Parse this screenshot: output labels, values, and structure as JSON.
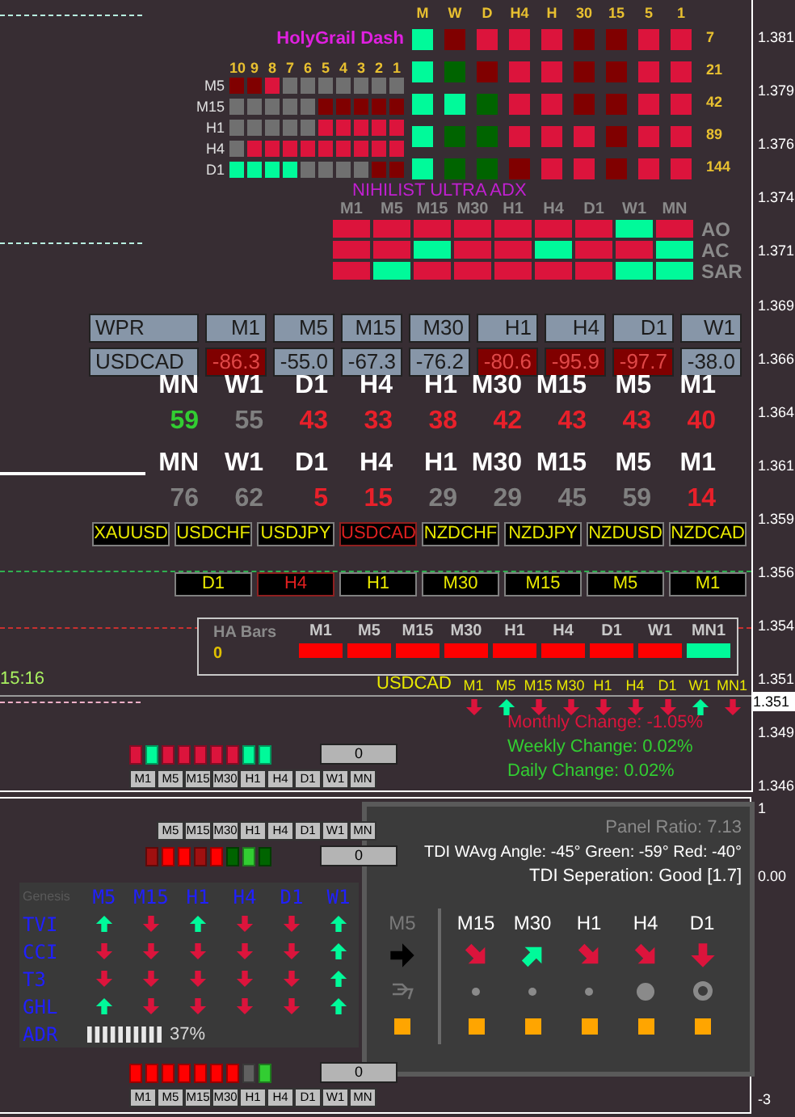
{
  "price_axis": {
    "labels": [
      "1.381",
      "1.379",
      "1.376",
      "1.374",
      "1.371",
      "1.369",
      "1.366",
      "1.364",
      "1.361",
      "1.359",
      "1.356",
      "1.354",
      "1.351",
      "1.349",
      "1.346"
    ],
    "current_price": "1.351"
  },
  "time_label": "15:16",
  "holygrail": {
    "title": "HolyGrail Dash",
    "columns": [
      "M",
      "W",
      "D",
      "H4",
      "H",
      "30",
      "15",
      "5",
      "1"
    ],
    "rows": [
      {
        "period": "7",
        "cells": [
          {
            "color": "#00fa9a"
          },
          {
            "color": "#800000"
          },
          {
            "color": "#dc143c"
          },
          {
            "color": "#dc143c"
          },
          {
            "color": "#dc143c"
          },
          {
            "color": "#800000"
          },
          {
            "color": "#800000"
          },
          {
            "color": "#dc143c"
          },
          {
            "color": "#dc143c"
          }
        ]
      },
      {
        "period": "21",
        "cells": [
          {
            "color": "#00fa9a"
          },
          {
            "color": "#006400"
          },
          {
            "color": "#800000"
          },
          {
            "color": "#dc143c"
          },
          {
            "color": "#dc143c"
          },
          {
            "color": "#800000"
          },
          {
            "color": "#800000"
          },
          {
            "color": "#dc143c"
          },
          {
            "color": "#dc143c"
          }
        ]
      },
      {
        "period": "42",
        "cells": [
          {
            "color": "#00fa9a"
          },
          {
            "color": "#00fa9a"
          },
          {
            "color": "#006400"
          },
          {
            "color": "#dc143c"
          },
          {
            "color": "#dc143c"
          },
          {
            "color": "#800000"
          },
          {
            "color": "#800000"
          },
          {
            "color": "#dc143c"
          },
          {
            "color": "#dc143c"
          }
        ]
      },
      {
        "period": "89",
        "cells": [
          {
            "color": "#00fa9a"
          },
          {
            "color": "#006400"
          },
          {
            "color": "#006400"
          },
          {
            "color": "#dc143c"
          },
          {
            "color": "#dc143c"
          },
          {
            "color": "#dc143c"
          },
          {
            "color": "#800000"
          },
          {
            "color": "#dc143c"
          },
          {
            "color": "#dc143c"
          }
        ]
      },
      {
        "period": "144",
        "cells": [
          {
            "color": "#00fa9a"
          },
          {
            "color": "#006400"
          },
          {
            "color": "#006400"
          },
          {
            "color": "#800000"
          },
          {
            "color": "#dc143c"
          },
          {
            "color": "#dc143c"
          },
          {
            "color": "#800000"
          },
          {
            "color": "#dc143c"
          },
          {
            "color": "#dc143c"
          }
        ]
      }
    ],
    "left_grid": {
      "columns": [
        "10",
        "9",
        "8",
        "7",
        "6",
        "5",
        "4",
        "3",
        "2",
        "1"
      ],
      "rows": [
        {
          "label": "M5",
          "cells": [
            {
              "color": "#800000"
            },
            {
              "color": "#800000"
            },
            {
              "color": "#dc143c"
            },
            {
              "color": "#707070"
            },
            {
              "color": "#707070"
            },
            {
              "color": "#707070"
            },
            {
              "color": "#707070"
            },
            {
              "color": "#707070"
            },
            {
              "color": "#707070"
            },
            {
              "color": "#707070"
            }
          ]
        },
        {
          "label": "M15",
          "cells": [
            {
              "color": "#707070"
            },
            {
              "color": "#707070"
            },
            {
              "color": "#707070"
            },
            {
              "color": "#707070"
            },
            {
              "color": "#707070"
            },
            {
              "color": "#800000"
            },
            {
              "color": "#800000"
            },
            {
              "color": "#800000"
            },
            {
              "color": "#800000"
            },
            {
              "color": "#800000"
            }
          ]
        },
        {
          "label": "H1",
          "cells": [
            {
              "color": "#707070"
            },
            {
              "color": "#707070"
            },
            {
              "color": "#707070"
            },
            {
              "color": "#707070"
            },
            {
              "color": "#707070"
            },
            {
              "color": "#dc143c"
            },
            {
              "color": "#dc143c"
            },
            {
              "color": "#dc143c"
            },
            {
              "color": "#dc143c"
            },
            {
              "color": "#dc143c"
            }
          ]
        },
        {
          "label": "H4",
          "cells": [
            {
              "color": "#707070"
            },
            {
              "color": "#dc143c"
            },
            {
              "color": "#dc143c"
            },
            {
              "color": "#dc143c"
            },
            {
              "color": "#dc143c"
            },
            {
              "color": "#dc143c"
            },
            {
              "color": "#dc143c"
            },
            {
              "color": "#dc143c"
            },
            {
              "color": "#dc143c"
            },
            {
              "color": "#dc143c"
            }
          ]
        },
        {
          "label": "D1",
          "cells": [
            {
              "color": "#00fa9a"
            },
            {
              "color": "#00fa9a"
            },
            {
              "color": "#00fa9a"
            },
            {
              "color": "#00fa9a"
            },
            {
              "color": "#707070"
            },
            {
              "color": "#707070"
            },
            {
              "color": "#707070"
            },
            {
              "color": "#707070"
            },
            {
              "color": "#800000"
            },
            {
              "color": "#800000"
            }
          ]
        }
      ]
    }
  },
  "adx": {
    "title": "NIHILIST ULTRA ADX",
    "columns": [
      "M1",
      "M5",
      "M15",
      "M30",
      "H1",
      "H4",
      "D1",
      "W1",
      "MN"
    ],
    "rows": [
      {
        "label": "AO",
        "cells": [
          {
            "color": "#dc143c"
          },
          {
            "color": "#dc143c"
          },
          {
            "color": "#dc143c"
          },
          {
            "color": "#dc143c"
          },
          {
            "color": "#dc143c"
          },
          {
            "color": "#dc143c"
          },
          {
            "color": "#dc143c"
          },
          {
            "color": "#00fa9a"
          },
          {
            "color": "#dc143c"
          }
        ]
      },
      {
        "label": "AC",
        "cells": [
          {
            "color": "#dc143c"
          },
          {
            "color": "#dc143c"
          },
          {
            "color": "#00fa9a"
          },
          {
            "color": "#dc143c"
          },
          {
            "color": "#dc143c"
          },
          {
            "color": "#00fa9a"
          },
          {
            "color": "#dc143c"
          },
          {
            "color": "#dc143c"
          },
          {
            "color": "#00fa9a"
          }
        ]
      },
      {
        "label": "SAR",
        "cells": [
          {
            "color": "#dc143c"
          },
          {
            "color": "#00fa9a"
          },
          {
            "color": "#dc143c"
          },
          {
            "color": "#dc143c"
          },
          {
            "color": "#dc143c"
          },
          {
            "color": "#dc143c"
          },
          {
            "color": "#dc143c"
          },
          {
            "color": "#00fa9a"
          },
          {
            "color": "#00fa9a"
          }
        ]
      }
    ]
  },
  "wpr": {
    "title": "WPR",
    "symbol": "USDCAD",
    "columns": [
      {
        "label": "M1",
        "value": "-86.3",
        "highlighted": true
      },
      {
        "label": "M5",
        "value": "-55.0",
        "highlighted": false
      },
      {
        "label": "M15",
        "value": "-67.3",
        "highlighted": false
      },
      {
        "label": "M30",
        "value": "-76.2",
        "highlighted": false
      },
      {
        "label": "H1",
        "value": "-80.6",
        "highlighted": true
      },
      {
        "label": "H4",
        "value": "-95.9",
        "highlighted": true
      },
      {
        "label": "D1",
        "value": "-97.7",
        "highlighted": true
      },
      {
        "label": "W1",
        "value": "-38.0",
        "highlighted": false
      }
    ]
  },
  "strength": [
    {
      "items": [
        {
          "label": "MN",
          "value": "59",
          "color": "#32cd32"
        },
        {
          "label": "W1",
          "value": "55",
          "color": "#808080"
        },
        {
          "label": "D1",
          "value": "43",
          "color": "#e8202a"
        },
        {
          "label": "H4",
          "value": "33",
          "color": "#e8202a"
        },
        {
          "label": "H1",
          "value": "38",
          "color": "#e8202a"
        },
        {
          "label": "M30",
          "value": "42",
          "color": "#e8202a"
        },
        {
          "label": "M15",
          "value": "43",
          "color": "#e8202a"
        },
        {
          "label": "M5",
          "value": "43",
          "color": "#e8202a"
        },
        {
          "label": "M1",
          "value": "40",
          "color": "#e8202a"
        }
      ]
    },
    {
      "items": [
        {
          "label": "MN",
          "value": "76",
          "color": "#808080"
        },
        {
          "label": "W1",
          "value": "62",
          "color": "#808080"
        },
        {
          "label": "D1",
          "value": "5",
          "color": "#e8202a"
        },
        {
          "label": "H4",
          "value": "15",
          "color": "#e8202a"
        },
        {
          "label": "H1",
          "value": "29",
          "color": "#808080"
        },
        {
          "label": "M30",
          "value": "29",
          "color": "#808080"
        },
        {
          "label": "M15",
          "value": "45",
          "color": "#808080"
        },
        {
          "label": "M5",
          "value": "59",
          "color": "#808080"
        },
        {
          "label": "M1",
          "value": "14",
          "color": "#e8202a"
        }
      ]
    }
  ],
  "symbols": [
    {
      "label": "XAUUSD",
      "selected": false
    },
    {
      "label": "USDCHF",
      "selected": false
    },
    {
      "label": "USDJPY",
      "selected": false
    },
    {
      "label": "USDCAD",
      "selected": true
    },
    {
      "label": "NZDCHF",
      "selected": false
    },
    {
      "label": "NZDJPY",
      "selected": false
    },
    {
      "label": "NZDUSD",
      "selected": false
    },
    {
      "label": "NZDCAD",
      "selected": false
    }
  ],
  "timeframes": [
    {
      "label": "D1",
      "selected": false
    },
    {
      "label": "H4",
      "selected": true
    },
    {
      "label": "H1",
      "selected": false
    },
    {
      "label": "M30",
      "selected": false
    },
    {
      "label": "M15",
      "selected": false
    },
    {
      "label": "M5",
      "selected": false
    },
    {
      "label": "M1",
      "selected": false
    }
  ],
  "ha_bars": {
    "title": "HA Bars",
    "value": "0",
    "columns": [
      {
        "label": "M1",
        "color": "#ff0000"
      },
      {
        "label": "M5",
        "color": "#ff0000"
      },
      {
        "label": "M15",
        "color": "#ff0000"
      },
      {
        "label": "M30",
        "color": "#ff0000"
      },
      {
        "label": "H1",
        "color": "#ff0000"
      },
      {
        "label": "H4",
        "color": "#ff0000"
      },
      {
        "label": "D1",
        "color": "#ff0000"
      },
      {
        "label": "W1",
        "color": "#ff0000"
      },
      {
        "label": "MN1",
        "color": "#00fa9a"
      }
    ]
  },
  "trend_arrows": {
    "symbol": "USDCAD",
    "items": [
      {
        "label": "M1",
        "kind": "down"
      },
      {
        "label": "M5",
        "kind": "up"
      },
      {
        "label": "M15",
        "kind": "down"
      },
      {
        "label": "M30",
        "kind": "down"
      },
      {
        "label": "H1",
        "kind": "down"
      },
      {
        "label": "H4",
        "kind": "down"
      },
      {
        "label": "D1",
        "kind": "down"
      },
      {
        "label": "W1",
        "kind": "up"
      },
      {
        "label": "MN1",
        "kind": "down"
      }
    ]
  },
  "changes": [
    {
      "text": "Monthly Change: -1.05%",
      "color": "#dc143c"
    },
    {
      "text": "Weekly Change: 0.02%",
      "color": "#32cd32"
    },
    {
      "text": "Daily Change: 0.02%",
      "color": "#32cd32"
    }
  ],
  "mini_widgets": [
    {
      "kind": "labels-below",
      "value": "0",
      "labels": [
        "M1",
        "M5",
        "M15",
        "M30",
        "H1",
        "H4",
        "D1",
        "W1",
        "MN"
      ],
      "cells": [
        {
          "color": "#dc143c"
        },
        {
          "color": "#00fa9a"
        },
        {
          "color": "#dc143c"
        },
        {
          "color": "#dc143c"
        },
        {
          "color": "#dc143c"
        },
        {
          "color": "#dc143c"
        },
        {
          "color": "#dc143c"
        },
        {
          "color": "#00fa9a"
        },
        {
          "color": "#00fa9a"
        }
      ]
    },
    {
      "kind": "labels-above",
      "value": "0",
      "labels": [
        "M5",
        "M15",
        "M30",
        "H1",
        "H4",
        "D1",
        "W1",
        "MN"
      ],
      "cells": [
        {
          "color": "#a01010"
        },
        {
          "color": "#ff0000"
        },
        {
          "color": "#ff0000"
        },
        {
          "color": "#a01010"
        },
        {
          "color": "#ff0000"
        },
        {
          "color": "#006400"
        },
        {
          "color": "#32cd32"
        },
        {
          "color": "#006400"
        }
      ]
    },
    {
      "kind": "labels-below",
      "value": "0",
      "labels": [
        "M1",
        "M5",
        "M15",
        "M30",
        "H1",
        "H4",
        "D1",
        "W1",
        "MN"
      ],
      "cells": [
        {
          "color": "#ff0000"
        },
        {
          "color": "#ff0000"
        },
        {
          "color": "#ff0000"
        },
        {
          "color": "#ff0000"
        },
        {
          "color": "#ff0000"
        },
        {
          "color": "#ff0000"
        },
        {
          "color": "#ff0000"
        },
        {
          "color": "#606060"
        },
        {
          "color": "#32cd32"
        }
      ]
    }
  ],
  "genesis": {
    "title": "Genesis",
    "columns": [
      "M5",
      "M15",
      "H1",
      "H4",
      "D1",
      "W1"
    ],
    "rows": [
      {
        "label": "TVI",
        "arrows": [
          {
            "kind": "up"
          },
          {
            "kind": "down"
          },
          {
            "kind": "up"
          },
          {
            "kind": "down"
          },
          {
            "kind": "down"
          },
          {
            "kind": "up"
          }
        ]
      },
      {
        "label": "CCI",
        "arrows": [
          {
            "kind": "down"
          },
          {
            "kind": "down"
          },
          {
            "kind": "down"
          },
          {
            "kind": "down"
          },
          {
            "kind": "down"
          },
          {
            "kind": "up"
          }
        ]
      },
      {
        "label": "T3",
        "arrows": [
          {
            "kind": "down"
          },
          {
            "kind": "down"
          },
          {
            "kind": "down"
          },
          {
            "kind": "down"
          },
          {
            "kind": "down"
          },
          {
            "kind": "up"
          }
        ]
      },
      {
        "label": "GHL",
        "arrows": [
          {
            "kind": "up"
          },
          {
            "kind": "down"
          },
          {
            "kind": "down"
          },
          {
            "kind": "down"
          },
          {
            "kind": "down"
          },
          {
            "kind": "up"
          }
        ]
      }
    ],
    "adr": {
      "label": "ADR",
      "reading": "37%"
    }
  },
  "tdi": {
    "ratio": "Panel Ratio: 7.13",
    "angle": "TDI WAvg Angle: -45° Green: -59° Red: -40°",
    "separation": "TDI Seperation: Good [1.7]",
    "columns": [
      {
        "label": "M5",
        "disabled": true
      },
      {
        "label": "M15",
        "disabled": false
      },
      {
        "label": "M30",
        "disabled": false
      },
      {
        "label": "H1",
        "disabled": false
      },
      {
        "label": "H4",
        "disabled": false
      },
      {
        "label": "D1",
        "disabled": false
      }
    ],
    "arrows": [
      {
        "kind": "right"
      },
      {
        "kind": "down-right"
      },
      {
        "kind": "up-right"
      },
      {
        "kind": "down-right"
      },
      {
        "kind": "down-right"
      },
      {
        "kind": "down"
      }
    ],
    "signals": [
      {
        "kind": "squiggle"
      },
      {
        "kind": "small-dot"
      },
      {
        "kind": "small-dot"
      },
      {
        "kind": "small-dot"
      },
      {
        "kind": "big-dot"
      },
      {
        "kind": "ring"
      }
    ]
  },
  "sub_axis": [
    "1",
    "0.00",
    "-3"
  ]
}
